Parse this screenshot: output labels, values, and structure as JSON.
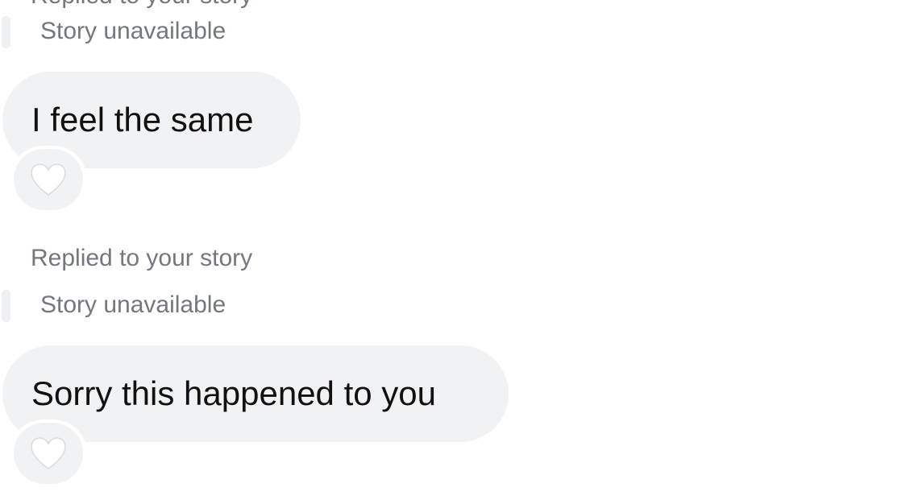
{
  "thread": {
    "top_partial_label": "Replied to your story",
    "messages": [
      {
        "story_label": "Story unavailable",
        "text": "I feel the same",
        "reaction_icon": "white-heart-icon"
      },
      {
        "reply_label": "Replied to your story",
        "story_label": "Story unavailable",
        "text": "Sorry this happened to you",
        "reaction_icon": "white-heart-icon"
      }
    ]
  },
  "colors": {
    "bubble": "#f1f2f4",
    "meta_text": "#73777f",
    "message_text": "#111111",
    "heart": "#ffffff"
  }
}
